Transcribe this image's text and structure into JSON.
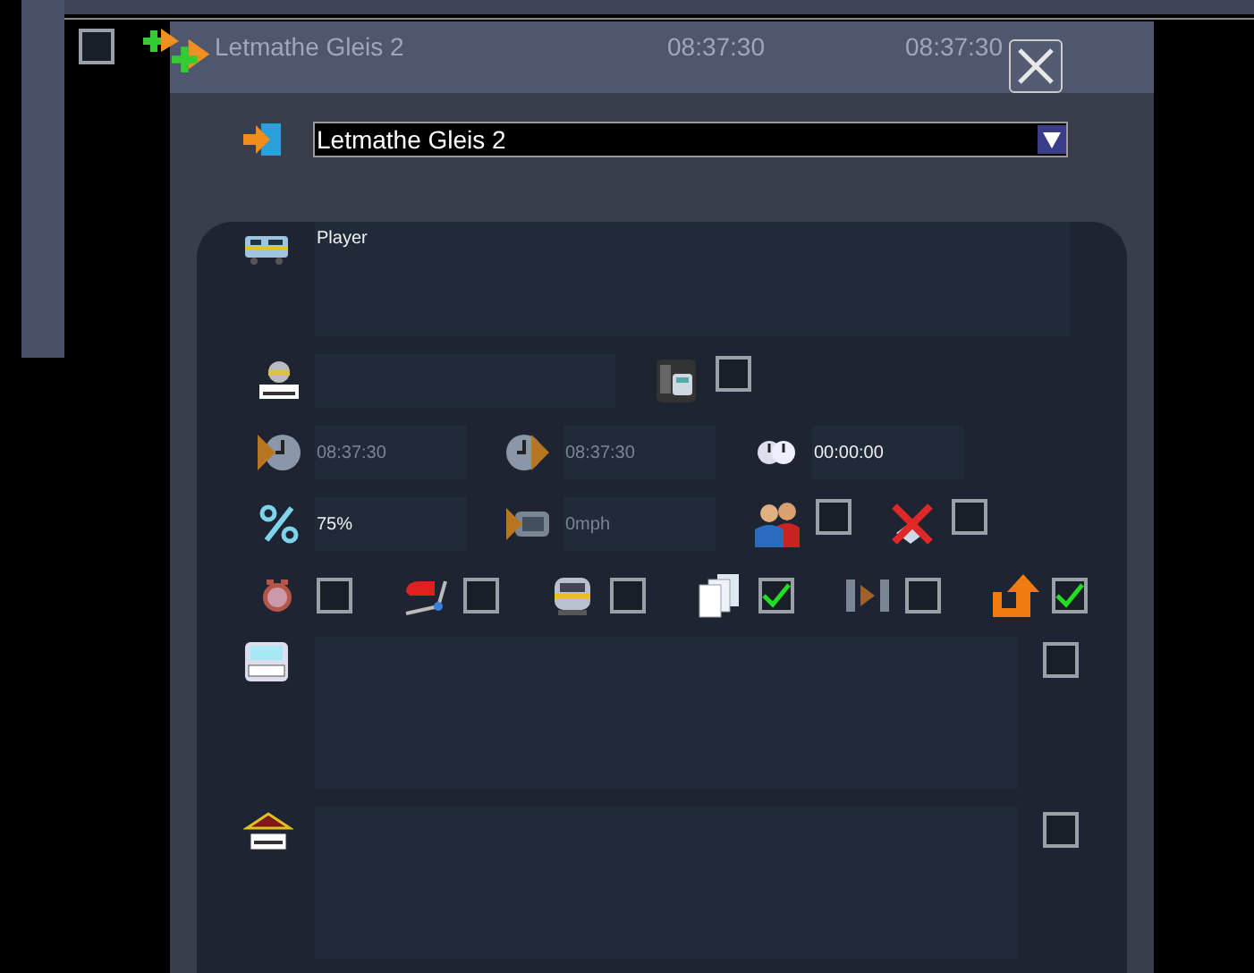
{
  "list_row": {
    "checked": false,
    "name": "Letmathe Gleis 2",
    "arrival": "08:37:30",
    "departure": "08:37:30"
  },
  "dialog": {
    "destination": {
      "value": "Letmathe Gleis 2"
    },
    "description": {
      "value": "Player"
    },
    "rows": [
      {
        "kind": "fields",
        "items": [
          {
            "kind": "field",
            "value": ""
          },
          {
            "kind": "checkbox",
            "checked": false
          }
        ]
      },
      {
        "kind": "fields",
        "items": [
          {
            "kind": "field",
            "value": "08:37:30",
            "disabled": true
          },
          {
            "kind": "field",
            "value": "08:37:30",
            "disabled": true
          },
          {
            "kind": "field",
            "value": "00:00:00",
            "disabled": false
          }
        ]
      },
      {
        "kind": "fields",
        "items": [
          {
            "kind": "field",
            "value": "75%",
            "disabled": false
          },
          {
            "kind": "field",
            "value": "0mph",
            "disabled": true
          },
          {
            "kind": "checkbox",
            "checked": false
          },
          {
            "kind": "checkbox",
            "checked": false
          }
        ]
      },
      {
        "kind": "toggles",
        "items": [
          {
            "checked": false
          },
          {
            "checked": false
          },
          {
            "checked": false
          },
          {
            "checked": true
          },
          {
            "checked": false
          },
          {
            "checked": true
          }
        ]
      },
      {
        "kind": "note",
        "value": "",
        "checked": false
      },
      {
        "kind": "note",
        "value": "",
        "checked": false
      }
    ]
  }
}
